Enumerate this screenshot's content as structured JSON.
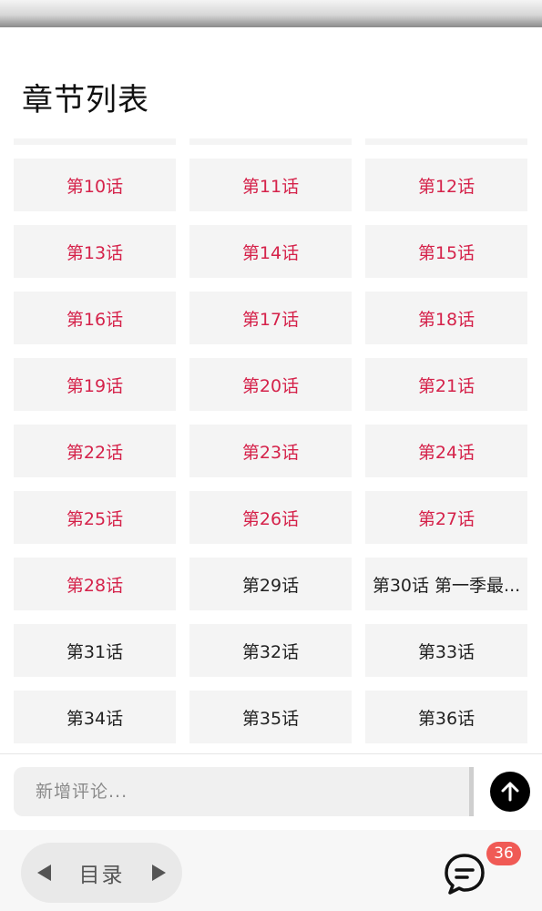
{
  "page": {
    "title": "章节列表"
  },
  "chapters": [
    {
      "label": "",
      "read": true
    },
    {
      "label": "",
      "read": true
    },
    {
      "label": "",
      "read": true
    },
    {
      "label": "第10话",
      "read": true
    },
    {
      "label": "第11话",
      "read": true
    },
    {
      "label": "第12话",
      "read": true
    },
    {
      "label": "第13话",
      "read": true
    },
    {
      "label": "第14话",
      "read": true
    },
    {
      "label": "第15话",
      "read": true
    },
    {
      "label": "第16话",
      "read": true
    },
    {
      "label": "第17话",
      "read": true
    },
    {
      "label": "第18话",
      "read": true
    },
    {
      "label": "第19话",
      "read": true
    },
    {
      "label": "第20话",
      "read": true
    },
    {
      "label": "第21话",
      "read": true
    },
    {
      "label": "第22话",
      "read": true
    },
    {
      "label": "第23话",
      "read": true
    },
    {
      "label": "第24话",
      "read": true
    },
    {
      "label": "第25话",
      "read": true
    },
    {
      "label": "第26话",
      "read": true
    },
    {
      "label": "第27话",
      "read": true
    },
    {
      "label": "第28话",
      "read": true
    },
    {
      "label": "第29话",
      "read": false
    },
    {
      "label": "第30话 第一季最...",
      "read": false
    },
    {
      "label": "第31话",
      "read": false
    },
    {
      "label": "第32话",
      "read": false
    },
    {
      "label": "第33话",
      "read": false
    },
    {
      "label": "第34话",
      "read": false
    },
    {
      "label": "第35话",
      "read": false
    },
    {
      "label": "第36话",
      "read": false
    }
  ],
  "colors": {
    "read": "#d5224a",
    "unread": "#222222",
    "badge": "#f05a55"
  },
  "comment": {
    "placeholder": "新增评论..."
  },
  "bottom_bar": {
    "toc_label": "目录",
    "comment_count": "36",
    "icons": [
      "prev-chapter-icon",
      "next-chapter-icon",
      "comment-bubble-icon",
      "send-arrow-icon"
    ]
  }
}
